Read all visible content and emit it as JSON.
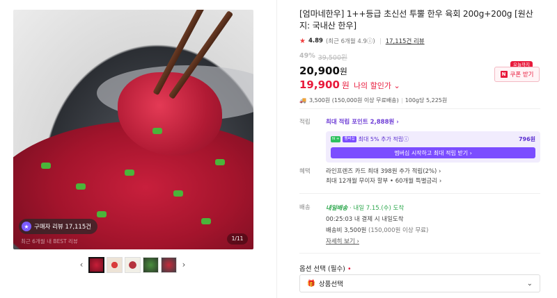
{
  "gallery": {
    "review_pill": "구매자 리뷰 17,115건",
    "sub_caption": "최근 6개월 내 BEST 리뷰",
    "counter": "1/11",
    "prev_arrow": "‹",
    "next_arrow": "›",
    "thumbs": [
      "thumb-1",
      "thumb-2",
      "thumb-3",
      "thumb-4",
      "thumb-5"
    ]
  },
  "product": {
    "title": "[엄마네한우] 1++등급 초신선 투뿔 한우 육회 200g+200g [원산지: 국내산 한우]",
    "rating": "4.89",
    "rating_recent": "(최근 6개월 4.9ⓘ)",
    "review_count": "17,115건 리뷰",
    "discount_pct": "49%",
    "original_price": "39,500원",
    "price": "20,900",
    "price_unit": "원",
    "my_price": "19,900",
    "my_price_unit": "원",
    "my_price_label": "나의 할인가 ⌄",
    "coupon_badge": "오늘까지",
    "coupon_button": "쿠폰 받기",
    "shipping": "3,500원 (150,000원 이상 무료배송)",
    "unit_price": "100g당 5,225원"
  },
  "points": {
    "label": "적립",
    "max_point": "최대 적립 포인트 2,888원 ›",
    "membership_chip": "N +",
    "membership_chip2": "멤버십",
    "membership_text": "최대 5% 추가 적립ⓘ",
    "membership_amount": "796원",
    "membership_cta": "멤버십 시작하고 최대 적립 받기 ›"
  },
  "benefits": {
    "label": "혜택",
    "line1": "라인프렌즈 카드 최대 398원 추가 적립(2%) ›",
    "line2": "최대 12개월 무이자 할부 • 60개월 특별금리 ›"
  },
  "delivery": {
    "label": "배송",
    "tag": "내일배송",
    "eta": "· 내일 7.15.(수) 도착",
    "deadline": "00:25:03  내 결제 시 내일도착",
    "fee": "배송비 3,500원",
    "fee_note": "(150,000원 이상 무료)",
    "more": "자세히 보기 ›"
  },
  "options": {
    "label": "옵션 선택 (필수)",
    "required_mark": "•",
    "select_value": "상품선택"
  },
  "colors": {
    "accent_red": "#e8193b",
    "membership_purple": "#7b4dff",
    "delivery_green": "#2ea84e"
  }
}
